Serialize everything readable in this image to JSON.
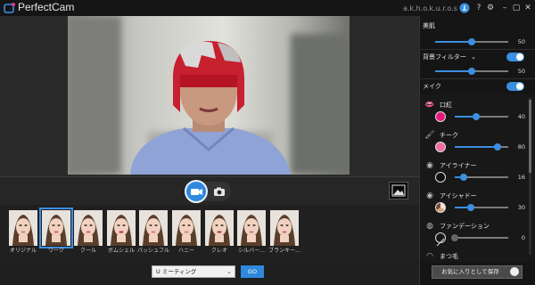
{
  "app": {
    "title": "PerfectCam",
    "user_name": "a.k.h.o.k.u.r.o.s",
    "titlebar_icons": [
      "notification-icon",
      "help-icon",
      "settings-icon",
      "minimize-icon",
      "maximize-icon",
      "close-icon"
    ]
  },
  "presets": {
    "selected_index": 1,
    "items": [
      {
        "label": "オリジナル",
        "lip": "#c98a8a"
      },
      {
        "label": "ワーク",
        "lip": "#d06b7a"
      },
      {
        "label": "クール",
        "lip": "#c86a86"
      },
      {
        "label": "ボムシェル",
        "lip": "#b8324f"
      },
      {
        "label": "パッシュフル",
        "lip": "#e0788e"
      },
      {
        "label": "ハニー",
        "lip": "#d9868a"
      },
      {
        "label": "クレオ",
        "lip": "#b03a50"
      },
      {
        "label": "シルバー...",
        "lip": "#c47e8a"
      },
      {
        "label": "ブランキー...",
        "lip": "#c46e7e"
      }
    ]
  },
  "bottom": {
    "dropdown_value": "U ミーティング",
    "go_label": "GO"
  },
  "panel": {
    "beauty": {
      "label": "美肌",
      "value": "50",
      "fraction": 0.5
    },
    "bg_filter": {
      "label": "背景フィルター",
      "value": "50",
      "fraction": 0.5,
      "enabled": true
    },
    "makeup": {
      "label": "メイク",
      "enabled": true
    },
    "items": [
      {
        "label": "口紅",
        "value": "40",
        "fraction": 0.4,
        "color": "#e6177a",
        "icon": "lips-icon"
      },
      {
        "label": "チーク",
        "value": "80",
        "fraction": 0.8,
        "color": "#f26fa0",
        "icon": "blush-brush-icon"
      },
      {
        "label": "アイライナー",
        "value": "16",
        "fraction": 0.16,
        "color": "#111111",
        "icon": "eye-icon"
      },
      {
        "label": "アイシャドー",
        "value": "30",
        "fraction": 0.3,
        "color": "#d9a07a",
        "icon": "eyeshadow-icon"
      },
      {
        "label": "ファンデーション",
        "value": "0",
        "fraction": 0.0,
        "color": "none",
        "icon": "foundation-icon"
      },
      {
        "label": "まつ毛",
        "icon": "eyelash-icon"
      }
    ],
    "favorite_button": "お気に入りとして保存"
  },
  "colors": {
    "accent": "#2f88dd"
  }
}
